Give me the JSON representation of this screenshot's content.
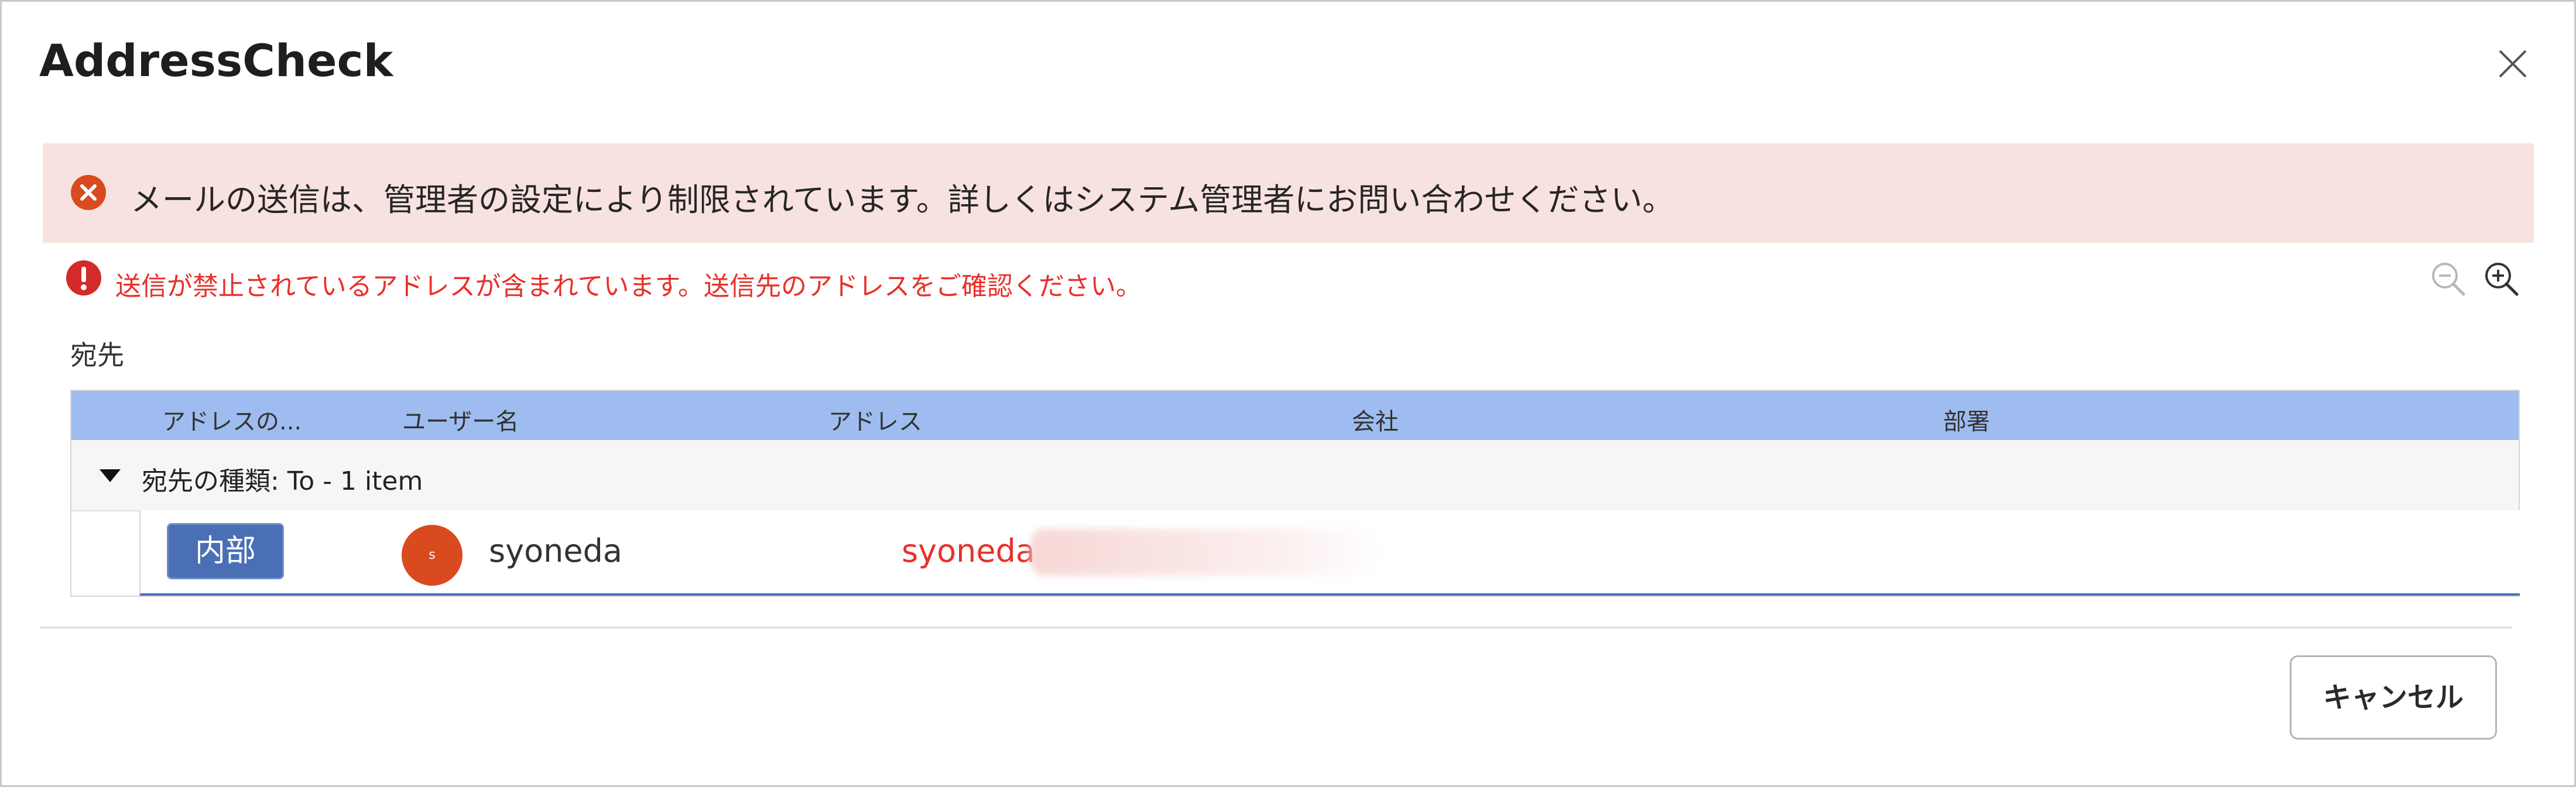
{
  "dialog": {
    "title": "AddressCheck",
    "close_icon": "close-icon"
  },
  "error_banner": {
    "icon": "error-circle-icon",
    "message": "メールの送信は、管理者の設定により制限されています。詳しくはシステム管理者にお問い合わせください。",
    "background_color": "#f8e2df"
  },
  "warning": {
    "icon": "exclamation-circle-icon",
    "message": "送信が禁止されているアドレスが含まれています。送信先のアドレスをご確認ください。",
    "color": "#e8302a"
  },
  "toolbar": {
    "zoom_out_icon": "zoom-out-icon",
    "zoom_in_icon": "zoom-in-icon"
  },
  "section": {
    "label": "宛先"
  },
  "grid": {
    "header_color": "#9ebcef",
    "columns": [
      "アドレスの...",
      "ユーザー名",
      "アドレス",
      "会社",
      "部署"
    ],
    "group": {
      "label": "宛先の種類: To - 1 item",
      "icon": "caret-down-icon"
    },
    "rows": [
      {
        "badge": "内部",
        "avatar_initial": "s",
        "username": "syoneda",
        "address": "syoneda",
        "company": "",
        "department": ""
      }
    ]
  },
  "footer": {
    "cancel_label": "キャンセル"
  }
}
